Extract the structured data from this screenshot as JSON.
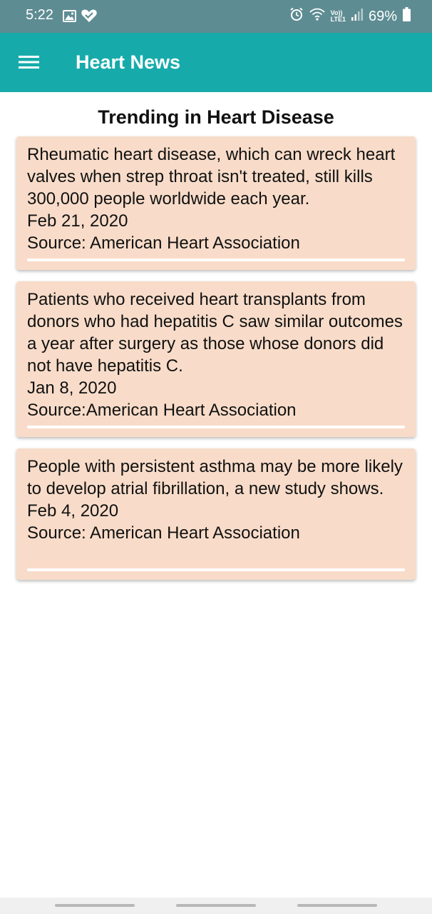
{
  "status_bar": {
    "time": "5:22",
    "battery": "69%",
    "icons": [
      "image-icon",
      "heart-check-icon",
      "alarm-icon",
      "wifi-icon",
      "volte-lte-icon",
      "signal-icon",
      "battery-icon"
    ],
    "volte_label": "Vo))",
    "lte_label": "LTE1"
  },
  "app_bar": {
    "title": "Heart News",
    "menu_icon": "hamburger-menu-icon",
    "background_color": "#16abaa"
  },
  "main": {
    "section_title": "Trending in Heart Disease",
    "cards": [
      {
        "headline": "Rheumatic heart disease, which can wreck heart valves when strep throat isn't treated, still kills 300,000 people worldwide each year.",
        "date": "Feb 21, 2020",
        "source": "Source: American Heart Association"
      },
      {
        "headline": "Patients who received heart transplants from donors who had hepatitis C saw similar outcomes a year after surgery as those whose donors did not have hepatitis C.",
        "date": "Jan 8, 2020",
        "source": "Source:American Heart Association"
      },
      {
        "headline": "People with persistent asthma may be more likely to develop atrial fibrillation, a new study shows.",
        "date": "Feb 4, 2020",
        "source": "Source: American Heart Association"
      }
    ],
    "card_color": "#f8dcc9"
  }
}
